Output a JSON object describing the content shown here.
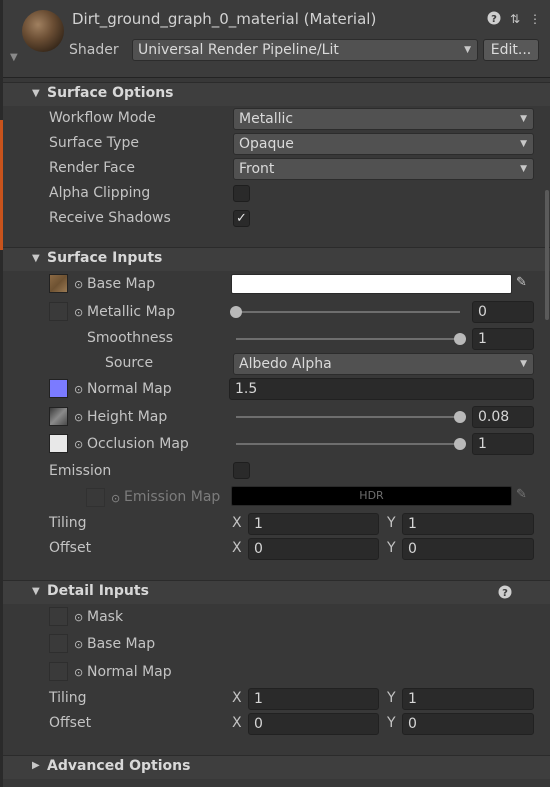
{
  "header": {
    "title": "Dirt_ground_graph_0_material (Material)",
    "shader_label": "Shader",
    "shader_value": "Universal Render Pipeline/Lit",
    "edit_label": "Edit..."
  },
  "surface_options": {
    "title": "Surface Options",
    "workflow_mode": {
      "label": "Workflow Mode",
      "value": "Metallic"
    },
    "surface_type": {
      "label": "Surface Type",
      "value": "Opaque"
    },
    "render_face": {
      "label": "Render Face",
      "value": "Front"
    },
    "alpha_clipping": {
      "label": "Alpha Clipping",
      "checked": false
    },
    "receive_shadows": {
      "label": "Receive Shadows",
      "checked": true,
      "glyph": "✓"
    }
  },
  "surface_inputs": {
    "title": "Surface Inputs",
    "base_map": {
      "label": "Base Map"
    },
    "metallic_map": {
      "label": "Metallic Map",
      "value": "0",
      "level": 0
    },
    "smoothness": {
      "label": "Smoothness",
      "value": "1",
      "level": 1
    },
    "source": {
      "label": "Source",
      "value": "Albedo Alpha"
    },
    "normal_map": {
      "label": "Normal Map",
      "value": "1.5"
    },
    "height_map": {
      "label": "Height Map",
      "value": "0.08",
      "level": 1
    },
    "occlusion_map": {
      "label": "Occlusion Map",
      "value": "1",
      "level": 1
    },
    "emission": {
      "label": "Emission",
      "checked": false
    },
    "emission_map": {
      "label": "Emission Map",
      "hdr": "HDR"
    },
    "tiling": {
      "label": "Tiling",
      "x_label": "X",
      "x": "1",
      "y_label": "Y",
      "y": "1"
    },
    "offset": {
      "label": "Offset",
      "x_label": "X",
      "x": "0",
      "y_label": "Y",
      "y": "0"
    }
  },
  "detail_inputs": {
    "title": "Detail Inputs",
    "mask": {
      "label": "Mask"
    },
    "base_map": {
      "label": "Base Map"
    },
    "normal_map": {
      "label": "Normal Map"
    },
    "tiling": {
      "label": "Tiling",
      "x_label": "X",
      "x": "1",
      "y_label": "Y",
      "y": "1"
    },
    "offset": {
      "label": "Offset",
      "x_label": "X",
      "x": "0",
      "y_label": "Y",
      "y": "0"
    }
  },
  "advanced_options": {
    "title": "Advanced Options"
  },
  "icons": {
    "help": "?",
    "presets": "⇅",
    "menu": "⋮",
    "caret_down": "▼",
    "caret_right": "▶",
    "picker": "✎",
    "object_dot": "⊙"
  },
  "colors": {
    "normal_map_swatch": "#7b7bff",
    "base_color": "#ffffff",
    "accent_strip": "#c8531c"
  }
}
